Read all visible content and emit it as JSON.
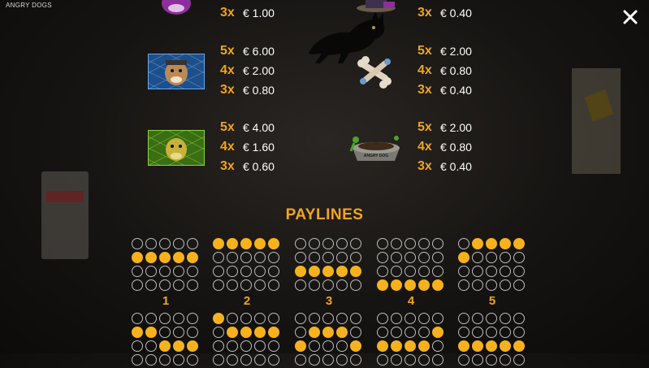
{
  "app": {
    "title": "ANGRY DOGS"
  },
  "close_label": "✕",
  "symbols": [
    {
      "id": "purple-dog",
      "pays": [
        {
          "mult": "3x",
          "value": "€ 1.00"
        }
      ]
    },
    {
      "id": "blue-dog",
      "pays": [
        {
          "mult": "5x",
          "value": "€ 6.00"
        },
        {
          "mult": "4x",
          "value": "€ 2.00"
        },
        {
          "mult": "3x",
          "value": "€ 0.80"
        }
      ]
    },
    {
      "id": "green-dog",
      "pays": [
        {
          "mult": "5x",
          "value": "€ 4.00"
        },
        {
          "mult": "4x",
          "value": "€ 1.60"
        },
        {
          "mult": "3x",
          "value": "€ 0.60"
        }
      ]
    },
    {
      "id": "dog-hat",
      "pays": [
        {
          "mult": "3x",
          "value": "€ 0.40"
        }
      ]
    },
    {
      "id": "bone",
      "pays": [
        {
          "mult": "5x",
          "value": "€ 2.00"
        },
        {
          "mult": "4x",
          "value": "€ 0.80"
        },
        {
          "mult": "3x",
          "value": "€ 0.40"
        }
      ]
    },
    {
      "id": "dog-bowl",
      "bowl_text": "ANGRY DOG",
      "pays": [
        {
          "mult": "5x",
          "value": "€ 2.00"
        },
        {
          "mult": "4x",
          "value": "€ 0.80"
        },
        {
          "mult": "3x",
          "value": "€ 0.40"
        }
      ]
    }
  ],
  "paylines_title": "PAYLINES",
  "paylines": [
    {
      "number": "1",
      "rows": [
        1,
        1,
        1,
        1,
        1
      ]
    },
    {
      "number": "2",
      "rows": [
        0,
        0,
        0,
        0,
        0
      ]
    },
    {
      "number": "3",
      "rows": [
        2,
        2,
        2,
        2,
        2
      ]
    },
    {
      "number": "4",
      "rows": [
        3,
        3,
        3,
        3,
        3
      ]
    },
    {
      "number": "5",
      "rows": [
        1,
        0,
        0,
        0,
        0
      ]
    }
  ],
  "paylines_partial": [
    {
      "rows": [
        1,
        1,
        2,
        2,
        2
      ]
    },
    {
      "rows": [
        0,
        1,
        1,
        1,
        1
      ]
    },
    {
      "rows": [
        2,
        1,
        1,
        1,
        2
      ]
    },
    {
      "rows": [
        2,
        2,
        2,
        2,
        1
      ]
    },
    {
      "rows": [
        2,
        2,
        2,
        2,
        2
      ]
    }
  ],
  "colors": {
    "accent": "#f2a51c",
    "dot_on": "#f6b21d",
    "dot_off": "#bdbdbd"
  }
}
